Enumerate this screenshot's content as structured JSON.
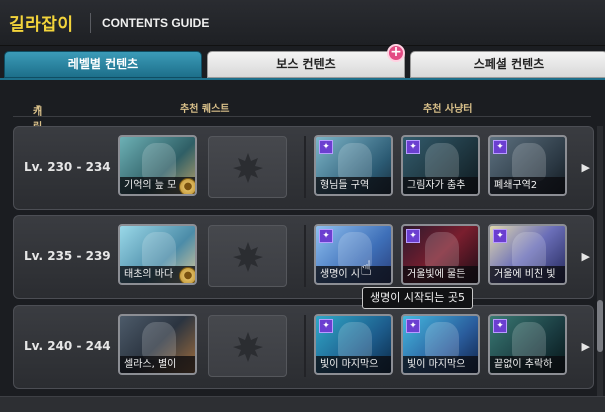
{
  "header": {
    "brand": "길라잡이",
    "title": "CONTENTS GUIDE"
  },
  "tabs": [
    {
      "label": "레벨별 컨텐츠",
      "active": true
    },
    {
      "label": "보스 컨텐츠",
      "active": false
    },
    {
      "label": "스페셜 컨텐츠",
      "active": false
    }
  ],
  "tab_badge": "+",
  "columns": {
    "level": "캐릭터 레벨",
    "quest": "추천 퀘스트",
    "hunting": "추천 사냥터"
  },
  "rows": [
    {
      "level": "Lv.  230 - 234",
      "quest": "기억의 늪 모",
      "hunting": [
        "형님들 구역",
        "그림자가 춤추",
        "폐쇄구역2"
      ]
    },
    {
      "level": "Lv.  235 - 239",
      "quest": "태초의 바다",
      "hunting": [
        "생명이 시",
        "거울빛에 물든",
        "거울에 비친 빛"
      ]
    },
    {
      "level": "Lv.  240 - 244",
      "quest": "셀라스, 별이",
      "hunting": [
        "빛이 마지막으",
        "빛이 마지막으",
        "끝없이 추락하"
      ]
    }
  ],
  "tooltip": "생명이 시작되는 곳5",
  "icons": {
    "star": "star-icon",
    "coin": "coin-icon",
    "empty": "maple-leaf-icon",
    "arrow": "chevron-right-icon",
    "chevron": "chevron-down-icon"
  },
  "colors": {
    "brand": "#f3d43b",
    "active_tab": "#1d6f8a",
    "header_text": "#d9c08a",
    "star_badge": "#6b3fd0"
  }
}
